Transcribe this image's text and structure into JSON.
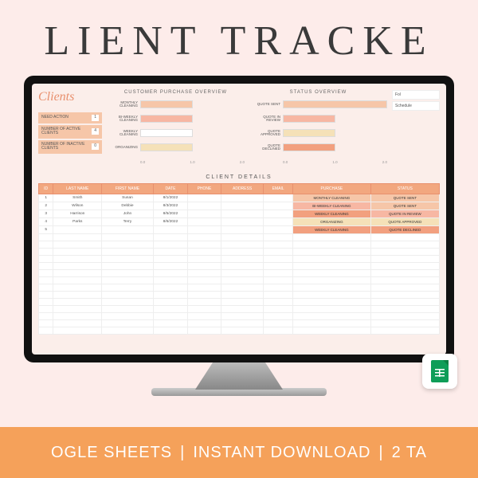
{
  "hero": {
    "title": "LIENT TRACKE"
  },
  "brand": "Clients",
  "stats": [
    {
      "label": "NEED ACTION",
      "value": 1
    },
    {
      "label": "NUMBER OF ACTIVE CLIENTS",
      "value": 4
    },
    {
      "label": "NUMBER OF INACTIVE CLIENTS",
      "value": 0
    }
  ],
  "chart_data": [
    {
      "type": "bar",
      "orientation": "horizontal",
      "title": "CUSTOMER PURCHASE OVERVIEW",
      "categories": [
        "MONTHLY CLEANING",
        "BI-WEEKLY CLEANING",
        "WEEKLY CLEANING",
        "ORGANIZING"
      ],
      "values": [
        1.0,
        1.0,
        1.0,
        1.0
      ],
      "colors": [
        "#f6c6a8",
        "#f7b7a3",
        "#fff",
        "#f5e1b8"
      ],
      "xlim": [
        0,
        2.0
      ],
      "xticks": [
        0,
        1.0,
        2.0
      ],
      "xlabel": "",
      "ylabel": ""
    },
    {
      "type": "bar",
      "orientation": "horizontal",
      "title": "STATUS OVERVIEW",
      "categories": [
        "QUOTE SENT",
        "QUOTE IN REVIEW",
        "QUOTE APPROVED",
        "QUOTE DECLINED"
      ],
      "values": [
        2.0,
        1.0,
        1.0,
        1.0
      ],
      "colors": [
        "#f6c6a8",
        "#f7b7a3",
        "#f5e1b8",
        "#f2a07f"
      ],
      "xlim": [
        0,
        2.0
      ],
      "xticks": [
        0,
        1.0,
        2.0
      ],
      "xlabel": "",
      "ylabel": ""
    }
  ],
  "side": {
    "items": [
      "Fol",
      "Schedule"
    ]
  },
  "table": {
    "title": "CLIENT DETAILS",
    "headers": [
      "ID",
      "LAST NAME",
      "FIRST NAME",
      "DATE",
      "PHONE",
      "ADDRESS",
      "EMAIL",
      "PURCHASE",
      "STATUS"
    ],
    "rows": [
      {
        "id": 1,
        "last": "Smith",
        "first": "Susan",
        "date": "8/1/2022",
        "phone": "",
        "address": "",
        "email": "",
        "purchase": "MONTHLY CLEANING",
        "purchase_class": "pill-monthly",
        "status": "QUOTE SENT",
        "status_class": "pill-qsent"
      },
      {
        "id": 2,
        "last": "Wilson",
        "first": "Debbie",
        "date": "8/3/2022",
        "phone": "",
        "address": "",
        "email": "",
        "purchase": "BI-WEEKLY CLEANING",
        "purchase_class": "pill-biweekly",
        "status": "QUOTE SENT",
        "status_class": "pill-qsent"
      },
      {
        "id": 3,
        "last": "Harrison",
        "first": "John",
        "date": "8/5/2022",
        "phone": "",
        "address": "",
        "email": "",
        "purchase": "WEEKLY CLEANING",
        "purchase_class": "pill-weekly",
        "status": "QUOTE IN REVIEW",
        "status_class": "pill-qreview"
      },
      {
        "id": 4,
        "last": "Parks",
        "first": "Terry",
        "date": "8/6/2022",
        "phone": "",
        "address": "",
        "email": "",
        "purchase": "ORGANIZING",
        "purchase_class": "pill-org",
        "status": "QUOTE APPROVED",
        "status_class": "pill-qapprove"
      },
      {
        "id": 5,
        "last": "",
        "first": "",
        "date": "",
        "phone": "",
        "address": "",
        "email": "",
        "purchase": "WEEKLY CLEANING",
        "purchase_class": "pill-weekly",
        "status": "QUOTE DECLINED",
        "status_class": "pill-qdecline"
      }
    ],
    "empty_rows": 14
  },
  "strip": {
    "items": [
      "OGLE SHEETS",
      "INSTANT DOWNLOAD",
      "2 TA"
    ],
    "separator": "|"
  }
}
